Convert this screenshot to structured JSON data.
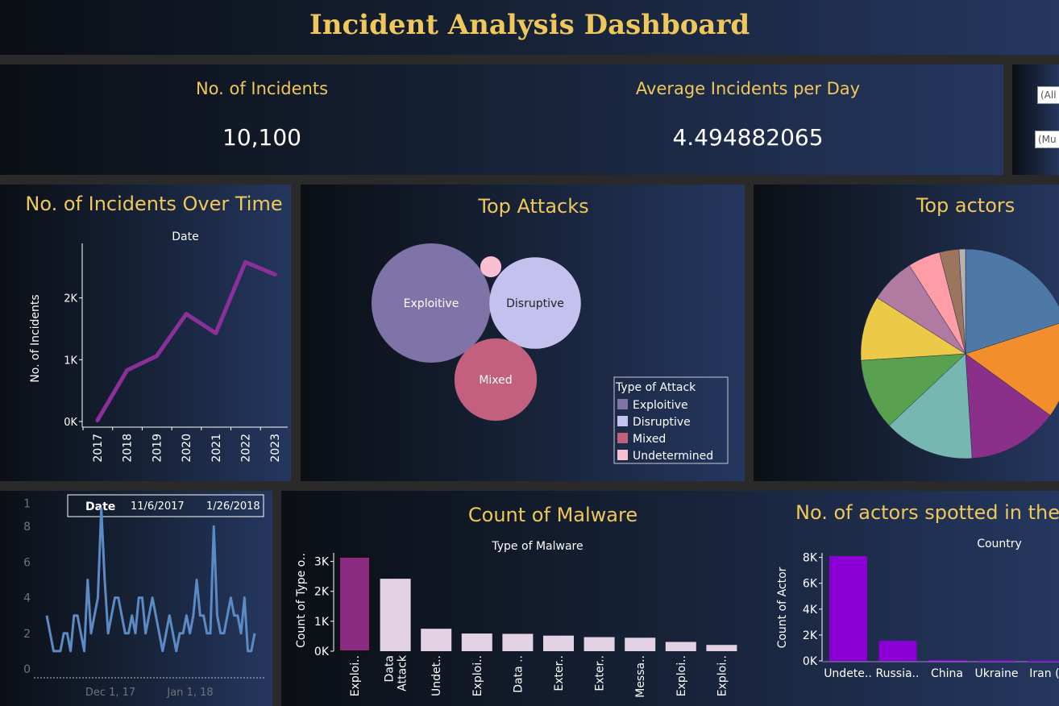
{
  "dashboard": {
    "title": "Incident Analysis Dashboard"
  },
  "kpis": {
    "incidents_label": "No. of Incidents",
    "incidents_value": "10,100",
    "avg_label": "Average Incidents per Day",
    "avg_value": "4.494882065"
  },
  "filters": {
    "filter1_value": "(All",
    "filter2_value": "(Mu"
  },
  "panels": {
    "over_time_title": "No. of Incidents Over Time",
    "top_attacks_title": "Top Attacks",
    "top_actors_title": "Top actors",
    "malware_title": "Count of Malware",
    "actors_country_title": "No. of actors spotted in the c"
  },
  "colors": {
    "gold": "#f0c85a",
    "line_purple": "#8b2f9a",
    "line_blue": "#5b8ac4",
    "exploitive": "#7f73a8",
    "disruptive": "#c5c1ee",
    "mixed": "#c2607d",
    "undetermined": "#f9c0d3",
    "malware_highlight": "#8a2a80",
    "malware_bar": "#e2d2e3",
    "country_bar": "#8a00d4"
  },
  "chart_data": [
    {
      "id": "over_time",
      "type": "line",
      "title": "Date",
      "xlabel": "Date",
      "ylabel": "No. of Incidents",
      "x": [
        "2017",
        "2018",
        "2019",
        "2020",
        "2021",
        "2022",
        "2023"
      ],
      "values": [
        20,
        830,
        1060,
        1740,
        1430,
        2580,
        2380
      ],
      "yticks": [
        0,
        1000,
        2000
      ],
      "ytick_labels": [
        "0K",
        "1K",
        "2K"
      ],
      "ylim": [
        0,
        2700
      ]
    },
    {
      "id": "top_attacks",
      "type": "bubble",
      "legend_title": "Type of Attack",
      "categories": [
        "Exploitive",
        "Disruptive",
        "Mixed",
        "Undetermined"
      ],
      "values": [
        4500,
        2650,
        2150,
        140
      ],
      "labels": [
        "Exploitive",
        "Disruptive",
        "Mixed",
        ""
      ]
    },
    {
      "id": "top_actors",
      "type": "pie",
      "values": [
        20,
        15,
        14,
        14,
        11,
        10,
        7,
        5,
        3,
        1
      ],
      "colors": [
        "#4e79a7",
        "#f28e2b",
        "#8a2f8a",
        "#76b7b2",
        "#59a14f",
        "#edc948",
        "#b07aa1",
        "#ff9da7",
        "#9c755f",
        "#bab0ac"
      ]
    },
    {
      "id": "daily_incidents",
      "type": "line",
      "filter_label": "Date",
      "filter_start": "11/6/2017",
      "filter_end": "1/26/2018",
      "x_tick_labels": [
        "Dec 1, 17",
        "Jan 1, 18"
      ],
      "ytick_labels": [
        "0",
        "2",
        "4",
        "6",
        "8",
        "1"
      ],
      "ylim": [
        0,
        9.5
      ],
      "values": [
        3,
        2,
        1,
        1,
        1,
        2,
        2,
        1,
        3,
        3,
        2,
        1,
        5,
        2,
        3,
        4,
        9,
        5,
        2,
        3,
        4,
        4,
        3,
        2,
        2,
        3,
        2,
        4,
        4,
        2,
        3,
        4,
        3,
        2,
        1,
        2,
        3,
        2,
        1,
        2,
        2,
        3,
        2,
        3,
        5,
        3,
        3,
        2,
        2,
        8,
        3,
        2,
        2,
        3,
        4,
        3,
        3,
        2,
        4,
        1,
        1,
        2
      ]
    },
    {
      "id": "malware",
      "type": "bar",
      "title": "Type of Malware",
      "ylabel": "Count of Type o..",
      "categories": [
        "Exploi..",
        "Data Attack",
        "Undet..",
        "Exploi..",
        "Data ..",
        "Exter..",
        "Exter..",
        "Messa..",
        "Exploi..",
        "Exploi.."
      ],
      "values": [
        3150,
        2420,
        750,
        590,
        580,
        520,
        470,
        450,
        310,
        210
      ],
      "yticks": [
        0,
        1000,
        2000,
        3000
      ],
      "ytick_labels": [
        "0K",
        "1K",
        "2K",
        "3K"
      ],
      "ylim": [
        -250,
        3300
      ]
    },
    {
      "id": "actors_by_country",
      "type": "bar",
      "title": "Country",
      "ylabel": "Count of Actor",
      "categories": [
        "Undete..",
        "Russia..",
        "China",
        "Ukraine",
        "Iran (I"
      ],
      "values": [
        8100,
        1550,
        60,
        40,
        30
      ],
      "yticks": [
        0,
        2000,
        4000,
        6000,
        8000
      ],
      "ytick_labels": [
        "0K",
        "2K",
        "4K",
        "6K",
        "8K"
      ],
      "ylim": [
        -500,
        8600
      ]
    }
  ]
}
